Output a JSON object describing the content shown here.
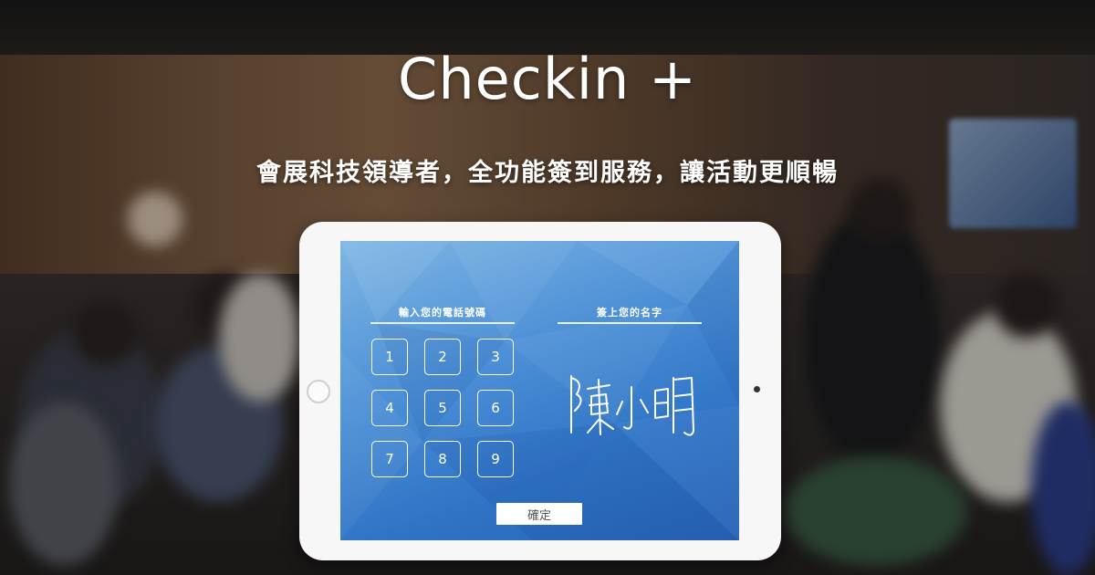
{
  "hero": {
    "title": "Checkin +",
    "subtitle": "會展科技領導者，全功能簽到服務，讓活動更順暢"
  },
  "tablet_screen": {
    "phone_section": {
      "heading": "輸入您的電話號碼",
      "keys": [
        "1",
        "2",
        "3",
        "4",
        "5",
        "6",
        "7",
        "8",
        "9"
      ]
    },
    "signature_section": {
      "heading": "簽上您的名字",
      "signature_text": "陳小明"
    },
    "confirm_label": "確定"
  },
  "colors": {
    "screen_gradient_top": "#7fb6e4",
    "screen_gradient_bottom": "#2763b6",
    "text": "#ffffff"
  }
}
